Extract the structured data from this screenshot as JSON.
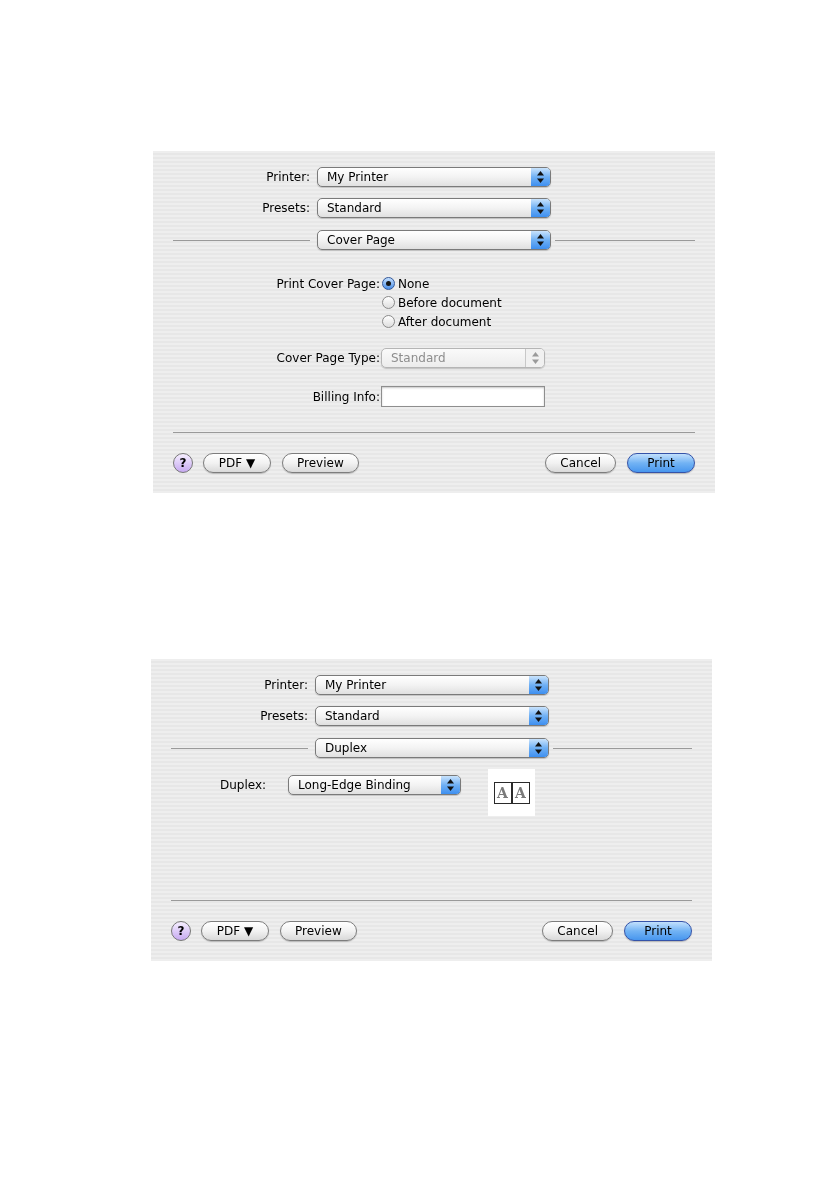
{
  "dialogs": [
    {
      "printer": {
        "label": "Printer:",
        "value": "My Printer"
      },
      "presets": {
        "label": "Presets:",
        "value": "Standard"
      },
      "panel": {
        "value": "Cover Page"
      },
      "options": [
        {
          "kind": "radio_group",
          "label": "Print Cover Page:",
          "choices": [
            {
              "label": "None",
              "selected": true
            },
            {
              "label": "Before document",
              "selected": false
            },
            {
              "label": "After document",
              "selected": false
            }
          ]
        },
        {
          "kind": "popup",
          "label": "Cover Page Type:",
          "value": "Standard",
          "disabled": true
        },
        {
          "kind": "text_field",
          "label": "Billing Info:"
        }
      ],
      "footer": {
        "help": "?",
        "left_buttons": [
          {
            "label": "PDF ▼"
          },
          {
            "label": "Preview"
          }
        ],
        "right_buttons": [
          {
            "label": "Cancel",
            "default": false
          },
          {
            "label": "Print",
            "default": true
          }
        ]
      }
    },
    {
      "printer": {
        "label": "Printer:",
        "value": "My Printer"
      },
      "presets": {
        "label": "Presets:",
        "value": "Standard"
      },
      "panel": {
        "value": "Duplex"
      },
      "options": [
        {
          "kind": "popup_preview",
          "label": "Duplex:",
          "value": "Long-Edge Binding",
          "disabled": false,
          "preview_pages": [
            "A",
            "A"
          ]
        }
      ],
      "footer": {
        "help": "?",
        "left_buttons": [
          {
            "label": "PDF ▼"
          },
          {
            "label": "Preview"
          }
        ],
        "right_buttons": [
          {
            "label": "Cancel",
            "default": false
          },
          {
            "label": "Print",
            "default": true
          }
        ]
      }
    }
  ]
}
